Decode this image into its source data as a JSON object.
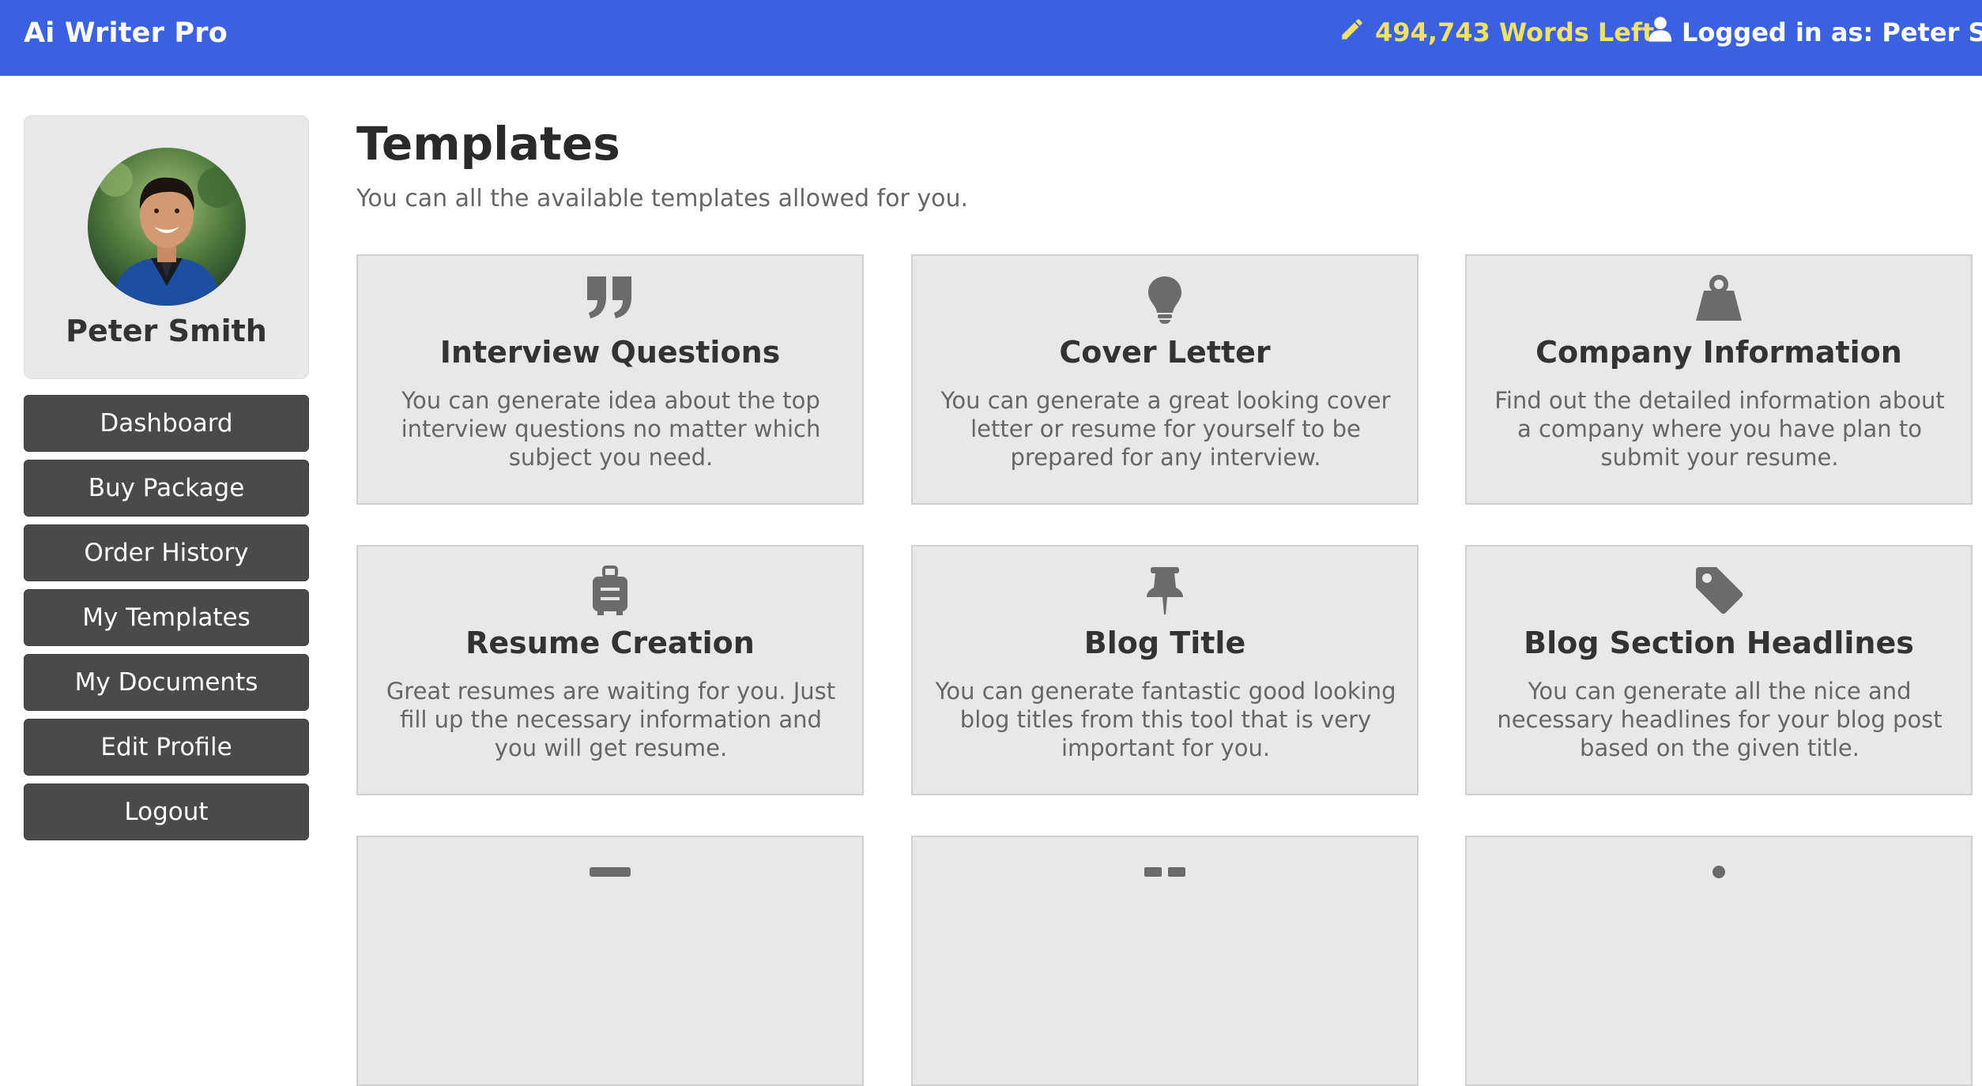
{
  "header": {
    "brand": "Ai Writer Pro",
    "words_left": "494,743 Words Left",
    "logged_in": "Logged in as: Peter Smith"
  },
  "sidebar": {
    "user_name": "Peter Smith",
    "items": [
      {
        "label": "Dashboard"
      },
      {
        "label": "Buy Package"
      },
      {
        "label": "Order History"
      },
      {
        "label": "My Templates"
      },
      {
        "label": "My Documents"
      },
      {
        "label": "Edit Profile"
      },
      {
        "label": "Logout"
      }
    ]
  },
  "main": {
    "title": "Templates",
    "subtitle": "You can all the available templates allowed for you.",
    "cards": [
      {
        "icon": "quote-icon",
        "title": "Interview Questions",
        "desc": "You can generate idea about the top interview questions no matter which subject you need."
      },
      {
        "icon": "lightbulb-icon",
        "title": "Cover Letter",
        "desc": "You can generate a great looking cover letter or resume for yourself to be prepared for any interview."
      },
      {
        "icon": "weight-icon",
        "title": "Company Information",
        "desc": "Find out the detailed information about a company where you have plan to submit your resume."
      },
      {
        "icon": "suitcase-icon",
        "title": "Resume Creation",
        "desc": "Great resumes are waiting for you. Just fill up the necessary information and you will get resume."
      },
      {
        "icon": "pin-icon",
        "title": "Blog Title",
        "desc": "You can generate fantastic good looking blog titles from this tool that is very important for you."
      },
      {
        "icon": "tag-icon",
        "title": "Blog Section Headlines",
        "desc": "You can generate all the nice and necessary headlines for your blog post based on the given title."
      }
    ]
  },
  "colors": {
    "header_bg": "#3a62e0",
    "words_left": "#f1e06a",
    "nav_button": "#4a4a4a",
    "card_bg": "#e8e8e8"
  }
}
